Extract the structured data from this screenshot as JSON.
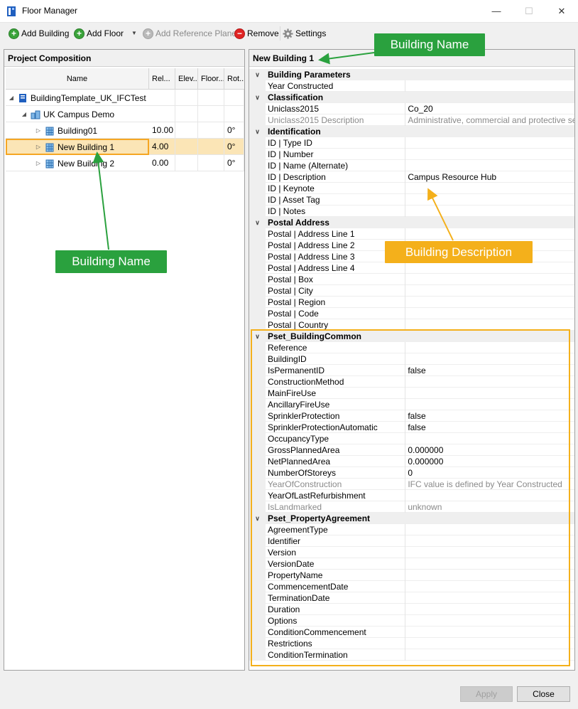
{
  "window": {
    "title": "Floor Manager",
    "controls": {
      "minimize": "—",
      "maximize": "☐",
      "close": "✕"
    }
  },
  "toolbar": {
    "add_building": "Add Building",
    "add_floor": "Add Floor",
    "add_reference_plane": "Add Reference Plane",
    "remove": "Remove",
    "settings": "Settings"
  },
  "left_panel": {
    "title": "Project Composition",
    "columns": [
      "Name",
      "Rel...",
      "Elev...",
      "Floor...",
      "Rot..."
    ],
    "tree": [
      {
        "name": "BuildingTemplate_UK_IFCTest",
        "rel": "",
        "elev": "",
        "floor": "",
        "rot": ""
      },
      {
        "name": "UK Campus Demo",
        "rel": "",
        "elev": "",
        "floor": "",
        "rot": ""
      },
      {
        "name": "Building01",
        "rel": "10.00",
        "elev": "",
        "floor": "",
        "rot": "0°"
      },
      {
        "name": "New Building 1",
        "rel": "4.00",
        "elev": "",
        "floor": "",
        "rot": "0°"
      },
      {
        "name": "New Building 2",
        "rel": "0.00",
        "elev": "",
        "floor": "",
        "rot": "0°"
      }
    ]
  },
  "right_panel": {
    "title": "New Building 1",
    "groups": [
      {
        "name": "Building Parameters",
        "rows": [
          {
            "label": "Year Constructed",
            "value": ""
          }
        ]
      },
      {
        "name": "Classification",
        "rows": [
          {
            "label": "Uniclass2015",
            "value": "Co_20"
          },
          {
            "label": "Uniclass2015 Description",
            "value": "Administrative, commercial and protective service o",
            "dim": true
          }
        ]
      },
      {
        "name": "Identification",
        "rows": [
          {
            "label": "ID | Type ID",
            "value": ""
          },
          {
            "label": "ID | Number",
            "value": ""
          },
          {
            "label": "ID | Name (Alternate)",
            "value": ""
          },
          {
            "label": "ID | Description",
            "value": "Campus Resource Hub"
          },
          {
            "label": "ID | Keynote",
            "value": ""
          },
          {
            "label": "ID | Asset Tag",
            "value": ""
          },
          {
            "label": "ID | Notes",
            "value": ""
          }
        ]
      },
      {
        "name": "Postal Address",
        "rows": [
          {
            "label": "Postal | Address Line 1",
            "value": ""
          },
          {
            "label": "Postal | Address Line 2",
            "value": ""
          },
          {
            "label": "Postal | Address Line 3",
            "value": ""
          },
          {
            "label": "Postal | Address Line 4",
            "value": ""
          },
          {
            "label": "Postal | Box",
            "value": ""
          },
          {
            "label": "Postal | City",
            "value": ""
          },
          {
            "label": "Postal | Region",
            "value": ""
          },
          {
            "label": "Postal | Code",
            "value": ""
          },
          {
            "label": "Postal | Country",
            "value": ""
          }
        ]
      },
      {
        "name": "Pset_BuildingCommon",
        "rows": [
          {
            "label": "Reference",
            "value": ""
          },
          {
            "label": "BuildingID",
            "value": ""
          },
          {
            "label": "IsPermanentID",
            "value": "false"
          },
          {
            "label": "ConstructionMethod",
            "value": ""
          },
          {
            "label": "MainFireUse",
            "value": ""
          },
          {
            "label": "AncillaryFireUse",
            "value": ""
          },
          {
            "label": "SprinklerProtection",
            "value": "false"
          },
          {
            "label": "SprinklerProtectionAutomatic",
            "value": "false"
          },
          {
            "label": "OccupancyType",
            "value": ""
          },
          {
            "label": "GrossPlannedArea",
            "value": "0.000000"
          },
          {
            "label": "NetPlannedArea",
            "value": "0.000000"
          },
          {
            "label": "NumberOfStoreys",
            "value": "0"
          },
          {
            "label": "YearOfConstruction",
            "value": "IFC value is defined by Year Constructed",
            "dim": true
          },
          {
            "label": "YearOfLastRefurbishment",
            "value": ""
          },
          {
            "label": "IsLandmarked",
            "value": "unknown",
            "dim": true
          }
        ]
      },
      {
        "name": "Pset_PropertyAgreement",
        "rows": [
          {
            "label": "AgreementType",
            "value": ""
          },
          {
            "label": "Identifier",
            "value": ""
          },
          {
            "label": "Version",
            "value": ""
          },
          {
            "label": "VersionDate",
            "value": ""
          },
          {
            "label": "PropertyName",
            "value": ""
          },
          {
            "label": "CommencementDate",
            "value": ""
          },
          {
            "label": "TerminationDate",
            "value": ""
          },
          {
            "label": "Duration",
            "value": ""
          },
          {
            "label": "Options",
            "value": ""
          },
          {
            "label": "ConditionCommencement",
            "value": ""
          },
          {
            "label": "Restrictions",
            "value": ""
          },
          {
            "label": "ConditionTermination",
            "value": ""
          }
        ]
      }
    ]
  },
  "annotations": {
    "callout_top": "Building Name",
    "callout_left": "Building Name",
    "callout_description": "Building Description"
  },
  "footer": {
    "apply": "Apply",
    "close": "Close"
  },
  "colors": {
    "callout_green": "#2aa13e",
    "callout_orange": "#f4b01b",
    "selection": "#fbe5b6"
  }
}
